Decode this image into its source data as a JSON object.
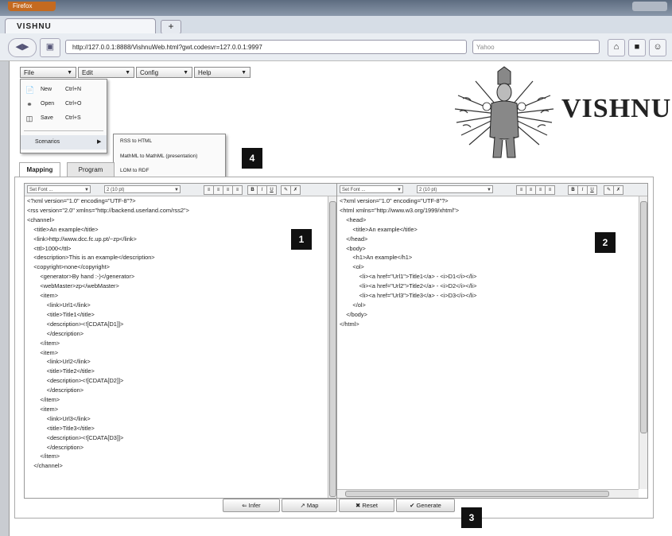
{
  "browser": {
    "app_button": "Firefox",
    "tab_title": "VISHNU",
    "new_tab": "+",
    "url": "http://127.0.0.1:8888/VishnuWeb.html?gwt.codesvr=127.0.0.1:9997",
    "search_placeholder": "Yahoo"
  },
  "menubar": {
    "file": "File",
    "edit": "Edit",
    "config": "Config",
    "help": "Help"
  },
  "file_menu": [
    {
      "label": "New",
      "shortcut": "Ctrl+N",
      "icon": "new-file-icon"
    },
    {
      "label": "Open",
      "shortcut": "Ctrl+O",
      "icon": "open-icon"
    },
    {
      "label": "Save",
      "shortcut": "Ctrl+S",
      "icon": "save-icon"
    }
  ],
  "scenarios": {
    "label": "Scenarios",
    "items": [
      "RSS to HTML",
      "MathML to MathML (presentation)",
      "LOM to RDF"
    ]
  },
  "logo": {
    "text": "VISHNU"
  },
  "tabs": {
    "mapping": "Mapping",
    "program": "Program"
  },
  "editor_toolbar": {
    "font": "Set Font ...",
    "size": "2 (10 pt)"
  },
  "left_editor": {
    "lines": [
      "<?xml version=\"1.0\" encoding=\"UTF-8\"?>",
      "<rss version=\"2.0\" xmlns=\"http://backend.userland.com/rss2\">",
      "<channel>",
      "    <title>An example</title>",
      "    <link>http://www.dcc.fc.up.pt/~zp</link>",
      "    <ttl>1000</ttl>",
      "    <description>This is an example</description>",
      "    <copyright>none</copyright>",
      "        <generator>By hand :-)</generator>",
      "        <webMaster>zp</webMaster>",
      "        <item>",
      "            <link>Url1</link>",
      "            <title>Title1</title>",
      "            <description><![CDATA[D1]]>",
      "            </description>",
      "        </item>",
      "        <item>",
      "            <link>Url2</link>",
      "            <title>Title2</title>",
      "            <description><![CDATA[D2]]>",
      "            </description>",
      "        </item>",
      "        <item>",
      "            <link>Url3</link>",
      "            <title>Title3</title>",
      "            <description><![CDATA[D3]]>",
      "            </description>",
      "        </item>",
      "    </channel>"
    ]
  },
  "right_editor": {
    "lines": [
      "<?xml version=\"1.0\" encoding=\"UTF-8\"?>",
      "<html xmlns=\"http://www.w3.org/1999/xhtml\">",
      "    <head>",
      "        <title>An example</title>",
      "    </head>",
      "    <body>",
      "        <h1>An example</h1>",
      "        <ol>",
      "            <li><a href=\"Url1\">Title1</a> - <i>D1</i></li>",
      "            <li><a href=\"Url2\">Title2</a> - <i>D2</i></li>",
      "            <li><a href=\"Url3\">Title3</a> - <i>D3</i></li>",
      "        </ol>",
      "    </body>",
      "</html>"
    ]
  },
  "buttons": {
    "infer": "Infer",
    "map": "Map",
    "reset": "Reset",
    "generate": "Generate"
  },
  "callouts": [
    "1",
    "2",
    "3",
    "4"
  ]
}
